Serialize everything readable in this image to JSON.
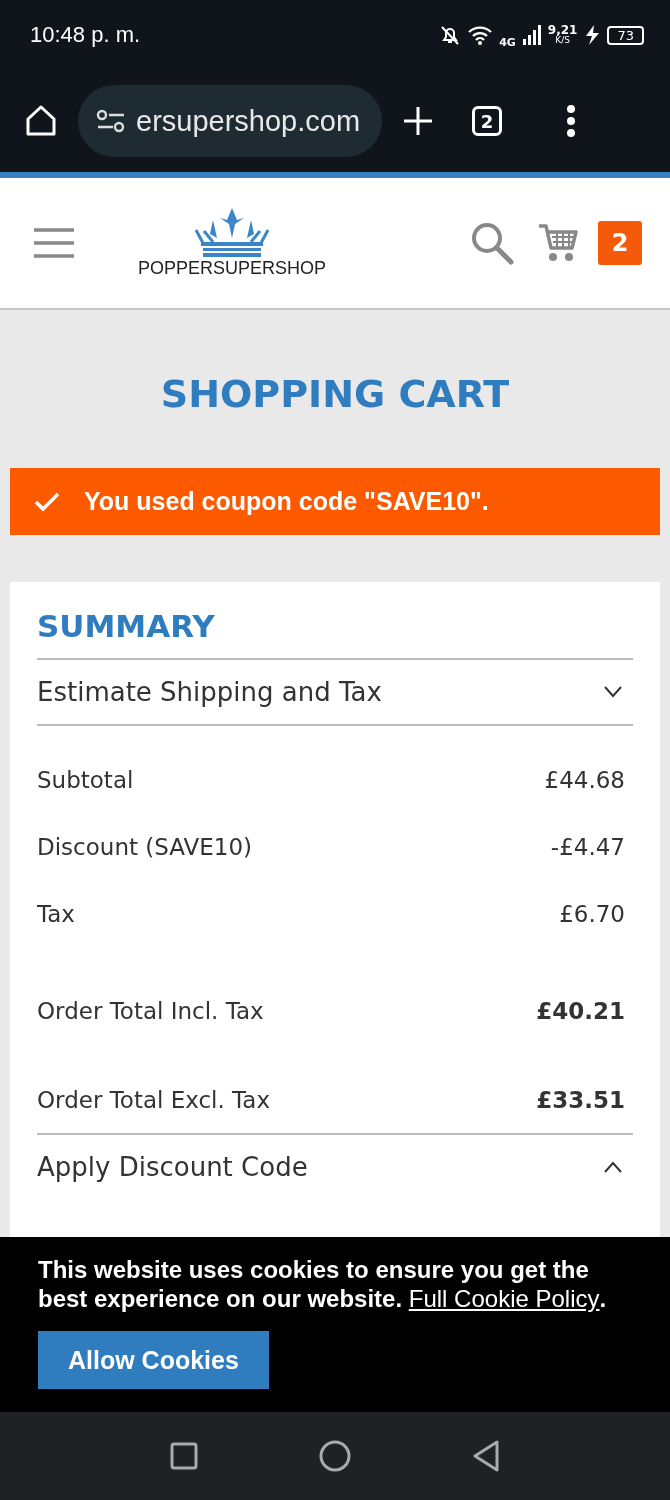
{
  "status_bar": {
    "time": "10:48 p. m.",
    "network": "4G",
    "speed": "9,21",
    "speed_unit": "K/S",
    "battery": "73"
  },
  "browser": {
    "url": "ersupershop.com",
    "tab_count": "2"
  },
  "header": {
    "logo_text": "POPPERSUPERSHOP",
    "cart_count": "2"
  },
  "page_title": "SHOPPING CART",
  "notice": "You used coupon code \"SAVE10\".",
  "summary": {
    "title": "SUMMARY",
    "sections": [
      {
        "label": "Estimate Shipping and Tax",
        "expanded": false
      }
    ],
    "rows": [
      {
        "label": "Subtotal",
        "value": "£44.68",
        "kind": "line"
      },
      {
        "label": "Discount (SAVE10)",
        "value": "-£4.47",
        "kind": "line"
      },
      {
        "label": "Tax",
        "value": "£6.70",
        "kind": "line"
      },
      {
        "label": "Order Total Incl. Tax",
        "value": "£40.21",
        "kind": "total"
      },
      {
        "label": "Order Total Excl. Tax",
        "value": "£33.51",
        "kind": "total"
      }
    ],
    "discount_section": {
      "label": "Apply Discount Code",
      "expanded": true
    }
  },
  "cookie_banner": {
    "text": "This website uses cookies to ensure you get the best experience on our website.",
    "link": "Full Cookie Policy",
    "after_link": ".",
    "button": "Allow Cookies"
  }
}
